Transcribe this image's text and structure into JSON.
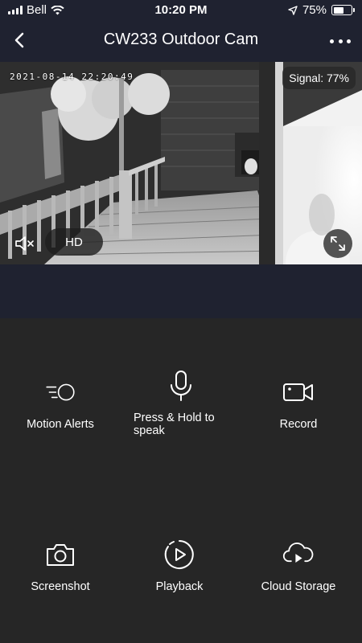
{
  "status_bar": {
    "carrier": "Bell",
    "time": "10:20 PM",
    "battery": "75%",
    "battery_level": 0.75
  },
  "nav": {
    "title": "CW233 Outdoor Cam"
  },
  "feed": {
    "timestamp": "2021-08-14 22:20:49",
    "signal": "Signal: 77%",
    "quality": "HD"
  },
  "controls": {
    "motion_alerts": "Motion Alerts",
    "talk": "Press & Hold to speak",
    "record": "Record",
    "screenshot": "Screenshot",
    "playback": "Playback",
    "cloud_storage": "Cloud Storage"
  },
  "colors": {
    "background": "#1f2230",
    "panel": "#262626"
  }
}
